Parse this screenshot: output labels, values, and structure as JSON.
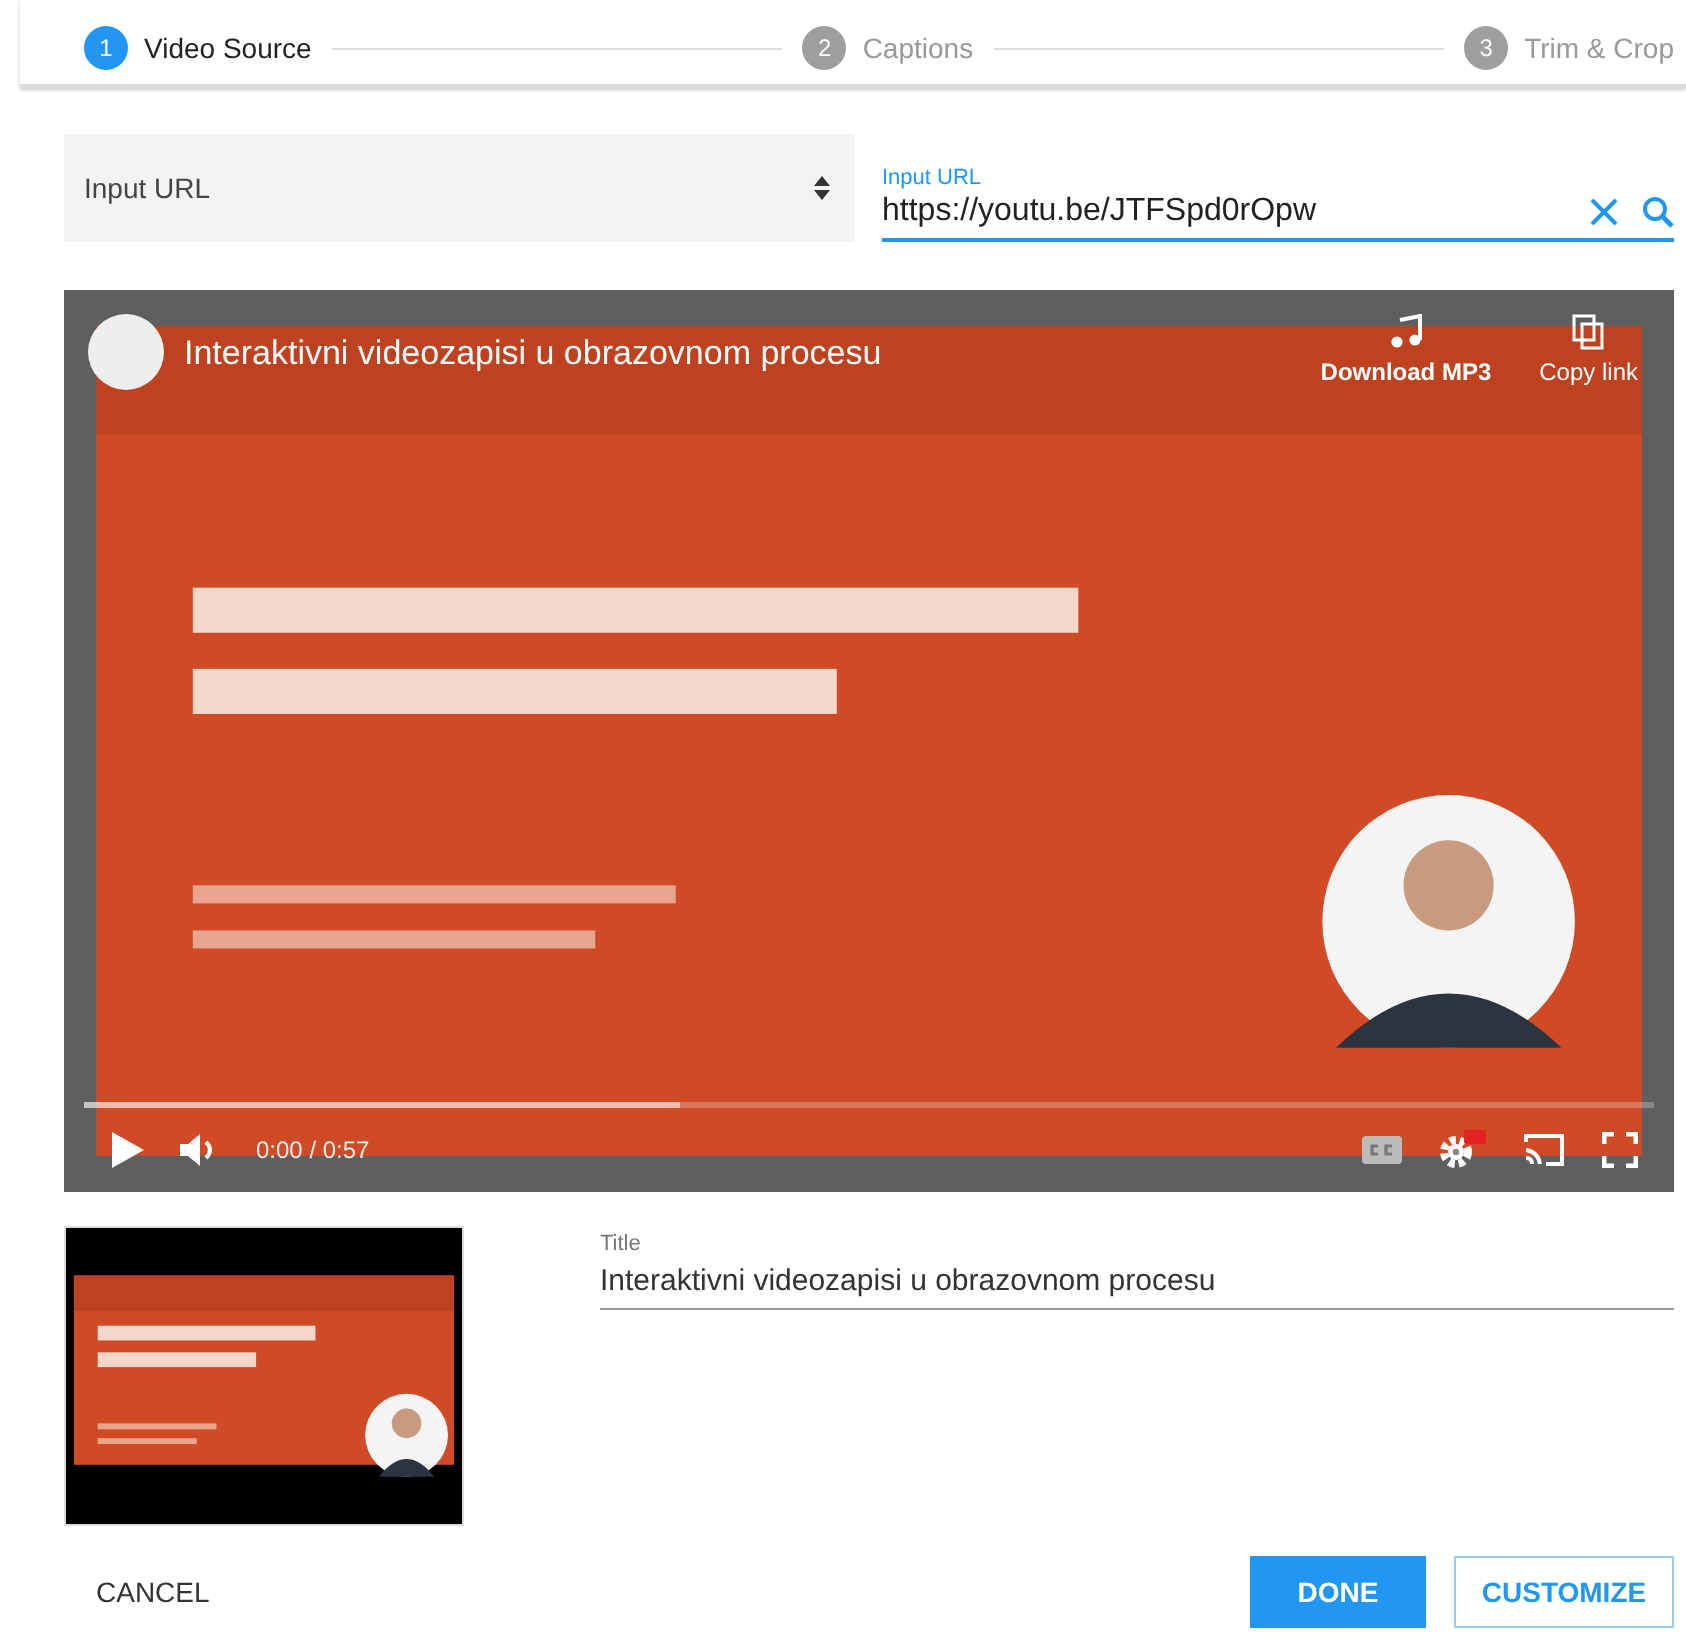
{
  "steps": [
    {
      "number": "1",
      "label": "Video Source",
      "selected": true
    },
    {
      "number": "2",
      "label": "Captions",
      "selected": false
    },
    {
      "number": "3",
      "label": "Trim & Crop",
      "selected": false
    }
  ],
  "source_select": {
    "value": "Input URL"
  },
  "url_field": {
    "label": "Input URL",
    "value": "https://youtu.be/JTFSpd0rOpw"
  },
  "player": {
    "title": "Interaktivni videozapisi u obrazovnom procesu",
    "actions": [
      "Download MP3",
      "Copy link"
    ],
    "time": "0:00 / 0:57",
    "progress": {
      "level": 0.38
    }
  },
  "title_field": {
    "label": "Title",
    "value": "Interaktivni videozapisi u obrazovnom procesu"
  },
  "buttons": {
    "cancel": "CANCEL",
    "done": "DONE",
    "customize": "CUSTOMIZE"
  }
}
